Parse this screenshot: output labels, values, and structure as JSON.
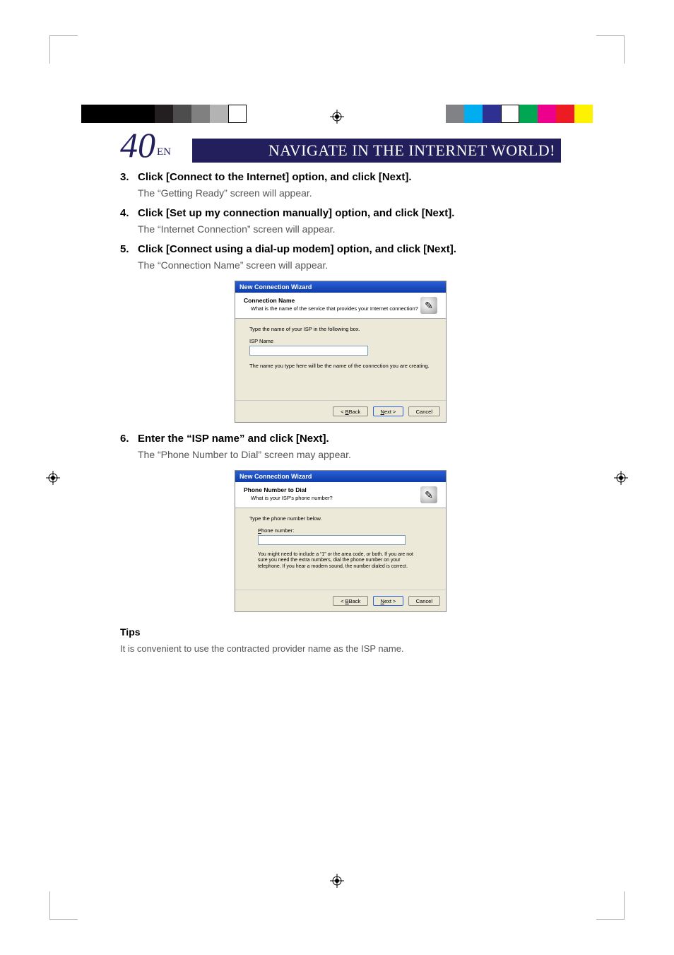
{
  "page_number": "40",
  "page_suffix": "EN",
  "header_title": "NAVIGATE IN THE INTERNET WORLD!",
  "steps": [
    {
      "num": "3.",
      "title": "Click [Connect to the Internet] option, and click [Next].",
      "body": "The “Getting Ready” screen will appear."
    },
    {
      "num": "4.",
      "title": "Click  [Set up my connection manually] option, and click [Next].",
      "body": "The “Internet Connection” screen will appear."
    },
    {
      "num": "5.",
      "title": "Click [Connect using a dial-up modem] option, and click [Next].",
      "body": "The “Connection Name” screen will appear."
    },
    {
      "num": "6.",
      "title": "Enter the “ISP name” and click [Next].",
      "body": "The “Phone Number to Dial” screen may appear."
    }
  ],
  "dialog1": {
    "window_title": "New Connection Wizard",
    "header_title": "Connection Name",
    "header_sub": "What is the name of the service that provides your Internet connection?",
    "label": "Type the name of your ISP in the following box.",
    "field_label": "ISP Name",
    "note": "The name you type here will be the name of the connection you are creating.",
    "btn_back": "Back",
    "btn_next": "Next >",
    "btn_cancel": "Cancel"
  },
  "dialog2": {
    "window_title": "New Connection Wizard",
    "header_title": "Phone Number to Dial",
    "header_sub": "What is your ISP's phone number?",
    "label": "Type the phone number below.",
    "field_label": "Phone number:",
    "note": "You might need to include a “1” or the area code, or both. If you are not sure you need the extra numbers, dial the phone number on your telephone. If you hear a modem sound, the number dialed is correct.",
    "btn_back": "Back",
    "btn_next": "Next >",
    "btn_cancel": "Cancel"
  },
  "tips_heading": "Tips",
  "tips_body": "It is convenient to use the contracted provider name as the ISP name.",
  "colorbar_left": [
    "#000",
    "#000",
    "#000",
    "#000",
    "#231f20",
    "#4d4d4d",
    "#808080",
    "#b3b3b3",
    "#fff"
  ],
  "colorbar_right": [
    "#fff200",
    "#ed1c24",
    "#ec008c",
    "#00a651",
    "#fff",
    "#2e3192",
    "#00aeef",
    "#808285"
  ]
}
